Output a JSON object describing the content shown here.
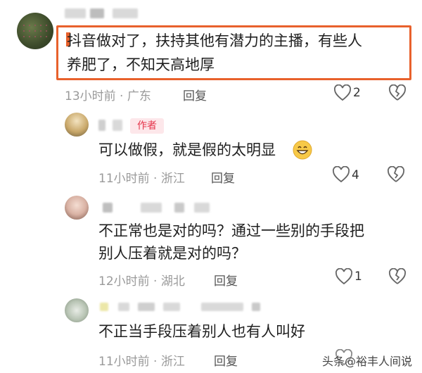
{
  "comments": [
    {
      "lines": [
        "抖音做对了，扶持其他有潜力的主播，有些人",
        "养肥了，不知天高地厚"
      ],
      "time_location": "13小时前 · 广东",
      "reply_label": "回复",
      "like_count": "2"
    },
    {
      "badge": "作者",
      "lines": [
        "可以做假，就是假的太明显"
      ],
      "time_location": "11小时前 · 浙江",
      "reply_label": "回复",
      "like_count": "4"
    },
    {
      "lines": [
        "不正常也是对的吗？通过一些别的手段把",
        "别人压着就是对的吗？"
      ],
      "time_location": "12小时前 · 湖北",
      "reply_label": "回复",
      "like_count": "1"
    },
    {
      "lines": [
        "不正当手段压着别人也有人叫好"
      ],
      "time_location": "11小时前 · 浙江",
      "reply_label": "回复",
      "like_count": ""
    }
  ],
  "watermark": "头条@裕丰人间说",
  "colors": {
    "highlight": "#e8612c",
    "badge_bg": "#fde7ea",
    "badge_text": "#e5354b",
    "meta": "#9a9a9a"
  },
  "icons": {
    "like": "heart-outline-icon",
    "dislike": "broken-heart-icon",
    "emoji": "grinning-face-icon"
  }
}
